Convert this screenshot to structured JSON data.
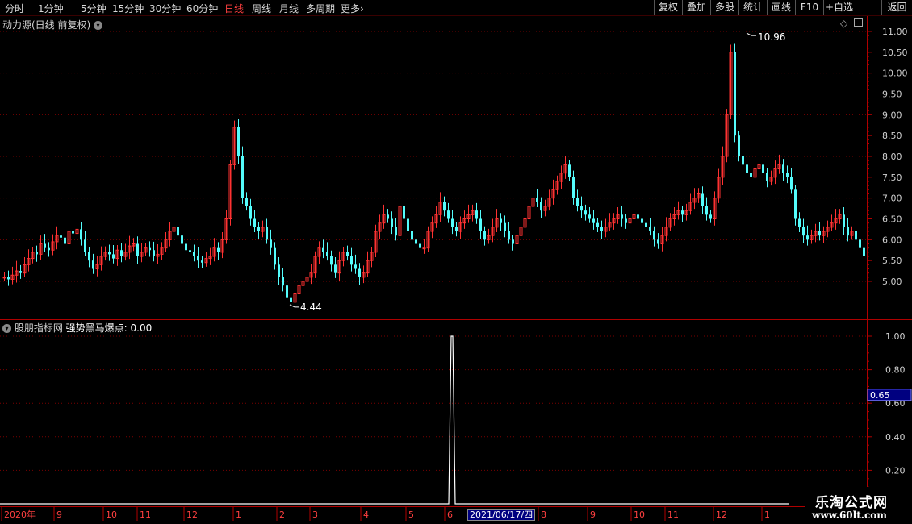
{
  "toolbar": {
    "periods": [
      "分时",
      "1分钟",
      "5分钟",
      "15分钟",
      "30分钟",
      "60分钟",
      "日线",
      "周线",
      "月线",
      "多周期",
      "更多"
    ],
    "active_period": "日线",
    "more_chevron": "›",
    "buttons": [
      "复权",
      "叠加",
      "多股",
      "统计",
      "画线",
      "F10",
      "+自选",
      "返回"
    ]
  },
  "main_panel": {
    "title": "动力源(日线 前复权)",
    "y_ticks": [
      "11.00",
      "10.50",
      "10.00",
      "9.50",
      "9.00",
      "8.50",
      "8.00",
      "7.50",
      "7.00",
      "6.50",
      "6.00",
      "5.50",
      "5.00"
    ],
    "high_label": "10.96",
    "low_label": "4.44"
  },
  "indicator_panel": {
    "title": "股朋指标网",
    "indicator_label": "强势黑马爆点: 0.00",
    "y_ticks": [
      "1.00",
      "0.80",
      "0.60",
      "0.40",
      "0.20"
    ],
    "cursor_value": "0.65"
  },
  "time_axis": {
    "labels": [
      "2020年",
      "9",
      "10",
      "11",
      "12",
      "1",
      "2",
      "3",
      "4",
      "5",
      "6",
      "8",
      "9",
      "10",
      "11",
      "12",
      "1"
    ],
    "cursor_date": "2021/06/17/四"
  },
  "watermark": {
    "line1": "乐淘公式网",
    "line2": "www.60lt.com"
  },
  "colors": {
    "up": "#ff3232",
    "down": "#54fcfc",
    "grid": "#7a0000",
    "axis": "#b00000",
    "indicator": "#ffffff"
  },
  "chart_data": [
    {
      "type": "candlestick",
      "title": "动力源(日线 前复权)",
      "ylim": [
        4.2,
        11.2
      ],
      "annotations": [
        {
          "label": "10.96",
          "value": 10.96
        },
        {
          "label": "4.44",
          "value": 4.44
        }
      ],
      "close": [
        5.1,
        5.05,
        5.15,
        5.25,
        5.2,
        5.4,
        5.55,
        5.7,
        5.65,
        5.9,
        5.8,
        5.75,
        5.95,
        6.1,
        6.05,
        5.9,
        6.2,
        6.15,
        6.25,
        6.0,
        5.7,
        5.5,
        5.3,
        5.4,
        5.6,
        5.7,
        5.65,
        5.55,
        5.75,
        5.6,
        5.7,
        5.85,
        5.9,
        5.6,
        5.7,
        5.8,
        5.75,
        5.6,
        5.65,
        5.8,
        6.0,
        6.2,
        6.3,
        6.1,
        5.9,
        5.75,
        5.7,
        5.6,
        5.5,
        5.45,
        5.55,
        5.6,
        5.8,
        5.7,
        6.0,
        6.5,
        7.8,
        8.7,
        8.0,
        7.0,
        6.8,
        6.5,
        6.3,
        6.2,
        6.3,
        6.0,
        5.8,
        5.4,
        5.1,
        4.9,
        4.6,
        4.5,
        4.7,
        4.9,
        5.0,
        5.1,
        5.2,
        5.6,
        5.8,
        5.7,
        5.6,
        5.4,
        5.2,
        5.5,
        5.7,
        5.6,
        5.4,
        5.3,
        5.1,
        5.2,
        5.5,
        5.7,
        6.2,
        6.4,
        6.6,
        6.5,
        6.3,
        6.1,
        6.8,
        6.5,
        6.2,
        6.0,
        5.9,
        5.8,
        5.8,
        6.2,
        6.4,
        6.6,
        6.9,
        6.7,
        6.5,
        6.3,
        6.2,
        6.4,
        6.5,
        6.6,
        6.7,
        6.5,
        6.2,
        6.0,
        6.1,
        6.3,
        6.5,
        6.4,
        6.2,
        6.0,
        5.9,
        6.1,
        6.3,
        6.5,
        6.8,
        7.0,
        6.9,
        6.7,
        6.8,
        7.0,
        7.2,
        7.4,
        7.6,
        7.8,
        7.5,
        7.0,
        6.8,
        6.7,
        6.6,
        6.5,
        6.4,
        6.3,
        6.2,
        6.3,
        6.4,
        6.5,
        6.6,
        6.5,
        6.4,
        6.5,
        6.6,
        6.5,
        6.4,
        6.3,
        6.2,
        6.0,
        5.9,
        6.1,
        6.3,
        6.5,
        6.6,
        6.7,
        6.6,
        6.7,
        6.9,
        7.0,
        7.1,
        6.8,
        6.6,
        6.5,
        7.0,
        7.5,
        8.0,
        9.0,
        10.5,
        8.5,
        8.0,
        7.8,
        7.6,
        7.5,
        7.7,
        7.8,
        7.6,
        7.4,
        7.5,
        7.7,
        7.8,
        7.6,
        7.5,
        7.2,
        6.5,
        6.3,
        6.1,
        6.0,
        6.1,
        6.2,
        6.1,
        6.2,
        6.3,
        6.4,
        6.5,
        6.6,
        6.3,
        6.1,
        6.2,
        6.0,
        5.8,
        5.6
      ]
    },
    {
      "type": "line",
      "series": [
        {
          "name": "强势黑马爆点",
          "spike_at_date": "2021/06/17/四",
          "spike_value": 1.0,
          "baseline": 0.0
        }
      ],
      "ylim": [
        0.0,
        1.05
      ]
    }
  ]
}
